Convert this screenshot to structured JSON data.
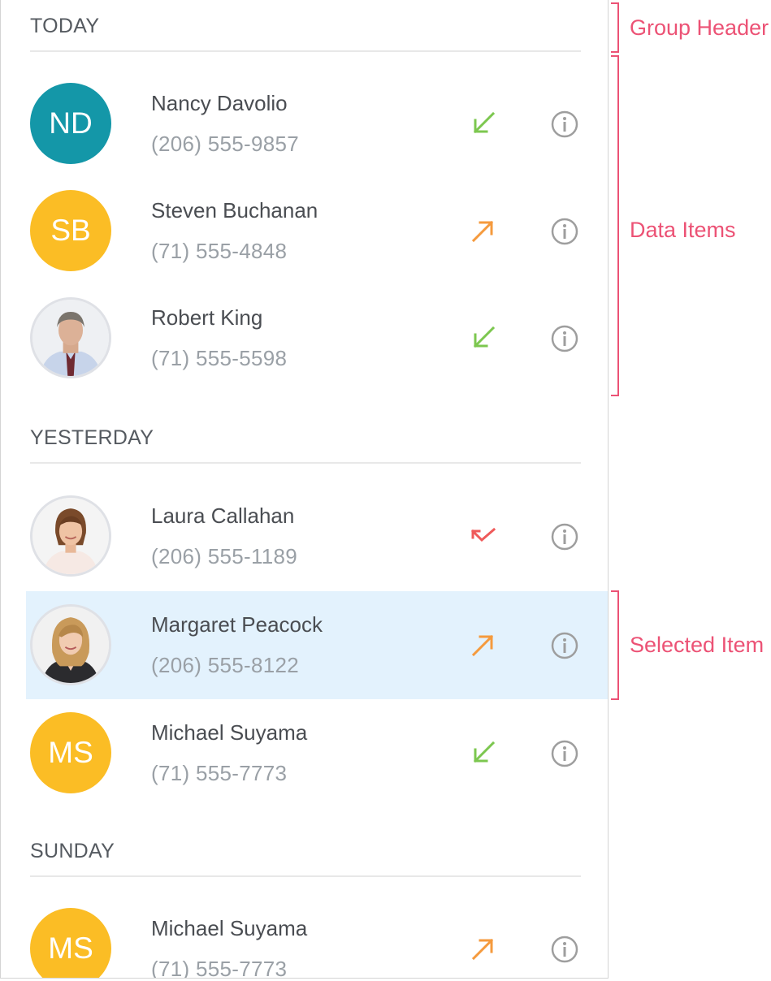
{
  "colors": {
    "accent_annotation": "#ec5275",
    "avatar_teal": "#1497a8",
    "avatar_yellow": "#fbbd25",
    "incoming": "#7cc74f",
    "outgoing": "#f59a3d",
    "missed": "#ef5a5a",
    "selected_bg": "#e3f2fd"
  },
  "groups": [
    {
      "header": "TODAY",
      "items": [
        {
          "initials": "ND",
          "name": "Nancy Davolio",
          "phone": "(206) 555-9857",
          "call_type": "incoming",
          "avatar_color": "#1497a8"
        },
        {
          "initials": "SB",
          "name": "Steven Buchanan",
          "phone": "(71) 555-4848",
          "call_type": "outgoing",
          "avatar_color": "#fbbd25"
        },
        {
          "photo": "man-in-suit-photo",
          "name": "Robert King",
          "phone": "(71) 555-5598",
          "call_type": "incoming"
        }
      ]
    },
    {
      "header": "YESTERDAY",
      "items": [
        {
          "photo": "woman-smiling-photo",
          "name": "Laura Callahan",
          "phone": "(206) 555-1189",
          "call_type": "missed"
        },
        {
          "photo": "blonde-woman-photo",
          "name": "Margaret Peacock",
          "phone": "(206) 555-8122",
          "call_type": "outgoing",
          "selected": true
        },
        {
          "initials": "MS",
          "name": "Michael Suyama",
          "phone": "(71) 555-7773",
          "call_type": "incoming",
          "avatar_color": "#fbbd25"
        }
      ]
    },
    {
      "header": "SUNDAY",
      "items": [
        {
          "initials": "MS",
          "name": "Michael Suyama",
          "phone": "(71) 555-7773",
          "call_type": "outgoing",
          "avatar_color": "#fbbd25"
        }
      ]
    }
  ],
  "icons": {
    "incoming": "arrow-down-left-icon",
    "outgoing": "arrow-up-right-icon",
    "missed": "missed-call-icon",
    "info": "info-icon"
  },
  "annotations": {
    "group_header": "Group Header",
    "data_items": "Data Items",
    "selected_item": "Selected Item"
  }
}
